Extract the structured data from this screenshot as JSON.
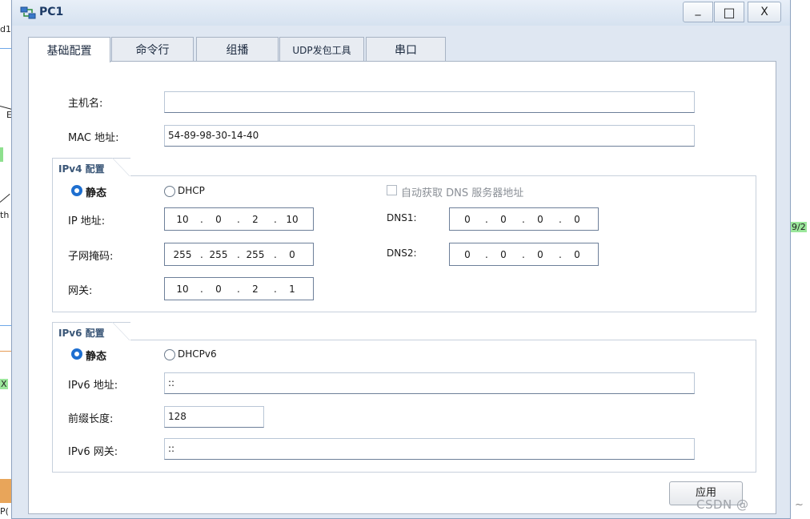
{
  "background": {
    "frag_top": "d1",
    "frag_mid": "th",
    "frag_b": "E",
    "frag_right": "9/2",
    "frag_bottom": "P(",
    "frag_x": "X",
    "tilde": "~"
  },
  "window": {
    "title": "PC1",
    "app_icon": "network-pc-icon",
    "min_glyph": "_",
    "max_glyph": "□",
    "close_glyph": "X"
  },
  "tabs": [
    "基础配置",
    "命令行",
    "组播",
    "UDP发包工具",
    "串口"
  ],
  "basic": {
    "hostname_label": "主机名:",
    "hostname_value": "",
    "mac_label": "MAC 地址:",
    "mac_value": "54-89-98-30-14-40"
  },
  "ipv4": {
    "group_title": "IPv4 配置",
    "static_label": "静态",
    "dhcp_label": "DHCP",
    "auto_dns_label": "自动获取 DNS 服务器地址",
    "ip_label": "IP 地址:",
    "ip": [
      "10",
      "0",
      "2",
      "10"
    ],
    "mask_label": "子网掩码:",
    "mask": [
      "255",
      "255",
      "255",
      "0"
    ],
    "gateway_label": "网关:",
    "gateway": [
      "10",
      "0",
      "2",
      "1"
    ],
    "dns1_label": "DNS1:",
    "dns1": [
      "0",
      "0",
      "0",
      "0"
    ],
    "dns2_label": "DNS2:",
    "dns2": [
      "0",
      "0",
      "0",
      "0"
    ],
    "dot": "."
  },
  "ipv6": {
    "group_title": "IPv6 配置",
    "static_label": "静态",
    "dhcp_label": "DHCPv6",
    "addr_label": "IPv6 地址:",
    "addr_value": "::",
    "prefix_label": "前缀长度:",
    "prefix_value": "128",
    "gateway_label": "IPv6 网关:",
    "gateway_value": "::"
  },
  "apply_label": "应用",
  "watermark": "CSDN @"
}
